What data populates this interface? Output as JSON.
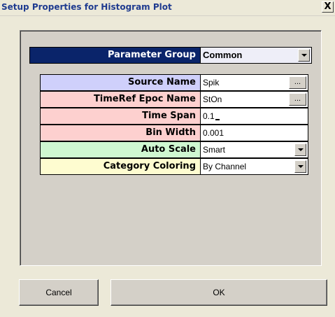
{
  "window": {
    "title": "Setup Properties for Histogram Plot",
    "close_label": "X"
  },
  "parameter_group": {
    "label": "Parameter Group",
    "value": "Common"
  },
  "properties": [
    {
      "label": "Source Name",
      "value": "Spik",
      "control": "ellipsis",
      "button_label": "...",
      "color": "#cfd0fb"
    },
    {
      "label": "TimeRef Epoc Name",
      "value": "StOn",
      "control": "ellipsis",
      "button_label": "...",
      "color": "#fdd0cf"
    },
    {
      "label": "Time Span",
      "value": "0.1",
      "control": "text",
      "color": "#fdd0cf"
    },
    {
      "label": "Bin Width",
      "value": "0.001",
      "control": "text",
      "color": "#fdd0cf"
    },
    {
      "label": "Auto Scale",
      "value": "Smart",
      "control": "dropdown",
      "color": "#cff7d1"
    },
    {
      "label": "Category Coloring",
      "value": "By Channel",
      "control": "dropdown",
      "color": "#fefcd0"
    }
  ],
  "buttons": {
    "cancel": "Cancel",
    "ok": "OK"
  }
}
